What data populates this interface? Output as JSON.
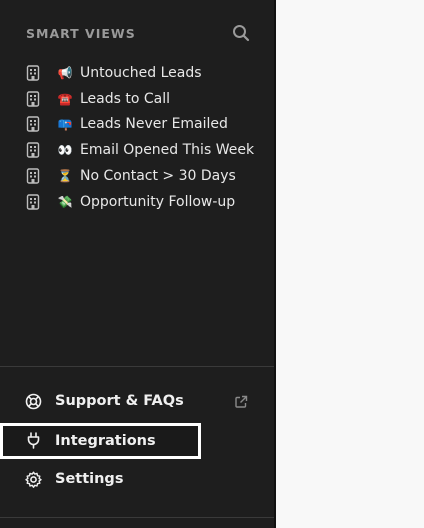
{
  "sidebar": {
    "section_title": "SMART VIEWS",
    "smart_views": [
      {
        "label": "Untouched Leads",
        "emoji": "📢",
        "icon": "document-icon"
      },
      {
        "label": "Leads to Call",
        "emoji": "☎️",
        "icon": "document-icon"
      },
      {
        "label": "Leads Never Emailed",
        "emoji": "📪",
        "icon": "document-icon"
      },
      {
        "label": "Email Opened This Week",
        "emoji": "👀",
        "icon": "document-icon"
      },
      {
        "label": "No Contact > 30 Days",
        "emoji": "⏳",
        "icon": "document-icon"
      },
      {
        "label": "Opportunity Follow-up",
        "emoji": "💸",
        "icon": "document-icon"
      }
    ],
    "nav": {
      "support": {
        "label": "Support & FAQs",
        "icon": "lifebuoy-icon",
        "external_icon": "external-link-icon"
      },
      "integrations": {
        "label": "Integrations",
        "icon": "plug-icon",
        "highlighted": true
      },
      "settings": {
        "label": "Settings",
        "icon": "gear-icon"
      }
    }
  },
  "colors": {
    "sidebar_bg": "#1e1e1e",
    "main_bg": "#f8f8f8",
    "highlight_border": "#ffffff",
    "section_title": "#9a9a9a"
  }
}
